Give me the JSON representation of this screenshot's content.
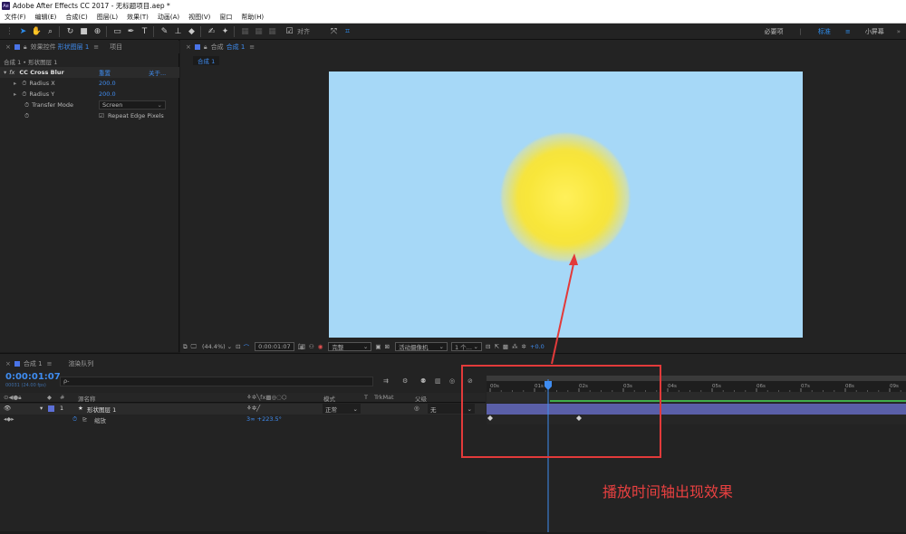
{
  "titlebar": {
    "app_icon": "Ae",
    "title": "Adobe After Effects CC 2017 - 无标题项目.aep *"
  },
  "menu": [
    "文件(F)",
    "编辑(E)",
    "合成(C)",
    "图层(L)",
    "效果(T)",
    "动画(A)",
    "视图(V)",
    "窗口",
    "帮助(H)"
  ],
  "toolbar": {
    "align_label": "对齐"
  },
  "workspaces": {
    "essentials": "必要项",
    "standard": "标准",
    "small_screen": "小屏幕"
  },
  "effects_panel": {
    "tab_prefix": "效果控件",
    "tab_layer": "形状图层 1",
    "project_tab": "项目",
    "breadcrumb": "合成 1 • 形状图层 1",
    "effect": {
      "fx": "fx",
      "name": "CC Cross Blur",
      "reset": "重置",
      "about": "关于..."
    },
    "props": [
      {
        "name": "Radius X",
        "value": "200.0"
      },
      {
        "name": "Radius Y",
        "value": "200.0"
      },
      {
        "name": "Transfer Mode",
        "value": "Screen"
      },
      {
        "name": "",
        "value": "Repeat Edge Pixels"
      }
    ]
  },
  "viewer": {
    "tab_prefix": "合成",
    "tab_name": "合成 1",
    "sub_tab": "合成 1",
    "zoom": "(44.4%)",
    "timecode": "0:00:01:07",
    "resolution": "完整",
    "camera": "活动摄像机",
    "views": "1 个...",
    "exposure": "+0.0",
    "comp_bg": "#a6d8f7",
    "blob_color": "#f6e43e"
  },
  "timeline": {
    "tab": "合成 1",
    "render_tab": "渲染队列",
    "timecode": "0:00:01:07",
    "timecode_sub": "00031 (24.00 fps)",
    "search_placeholder": "ρ-",
    "headers": {
      "num": "#",
      "source": "源名称",
      "mode": "模式",
      "t": "T",
      "trkmat": "TrkMat",
      "parent": "父级"
    },
    "layer": {
      "num": "1",
      "name": "形状图层 1",
      "mode": "正常",
      "parent": "无"
    },
    "prop": {
      "name": "缩放",
      "value": "3∞ +223.5°"
    },
    "ruler": [
      "00s",
      "01s",
      "02s",
      "03s",
      "04s",
      "05s",
      "06s",
      "07s",
      "08s",
      "09s"
    ]
  },
  "annotation": {
    "text": "播放时间轴出现效果",
    "color": "#e84040"
  }
}
